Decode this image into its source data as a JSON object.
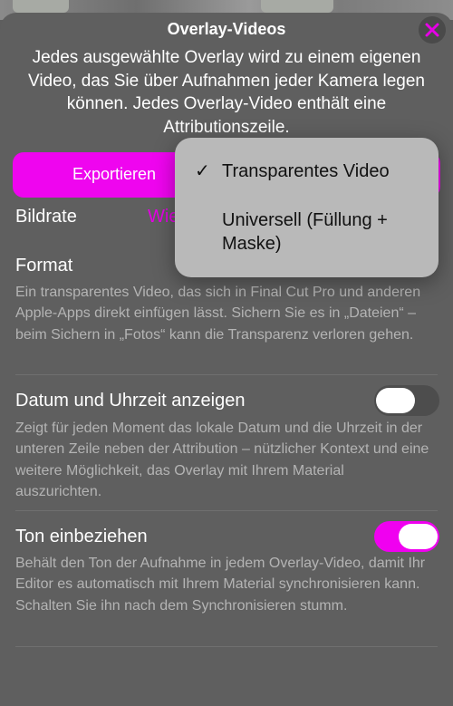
{
  "sheet": {
    "title": "Overlay-Videos",
    "intro": "Jedes ausgewählte Overlay wird zu einem eigenen Video, das Sie über Aufnahmen jeder Kamera legen können. Jedes Overlay-Video enthält eine Attributionszeile."
  },
  "export": {
    "label": "Exportieren"
  },
  "bildrate": {
    "label": "Bildrate",
    "value": "Wie"
  },
  "format": {
    "label": "Format",
    "description": "Ein transparentes Video, das sich in Final Cut Pro und anderen Apple-Apps direkt einfügen lässt. Sichern Sie es in „Dateien“ – beim Sichern in „Fotos“ kann die Transparenz verloren gehen."
  },
  "datetime": {
    "label": "Datum und Uhrzeit anzeigen",
    "description": "Zeigt für jeden Moment das lokale Datum und die Uhrzeit in der unteren Zeile neben der Attribution – nützlicher Kontext und eine weitere Möglichkeit, das Overlay mit Ihrem Material auszurichten.",
    "enabled": false
  },
  "sound": {
    "label": "Ton einbeziehen",
    "description": "Behält den Ton der Aufnahme in jedem Overlay-Video, damit Ihr Editor es automatisch mit Ihrem Material synchronisieren kann. Schalten Sie ihn nach dem Synchronisieren stumm.",
    "enabled": true
  },
  "format_menu": {
    "check": "✓",
    "options": [
      "Transparentes Video",
      "Universell (Füllung + Maske)"
    ],
    "selected": "Transparentes Video"
  },
  "colors": {
    "accent": "#ef05ef",
    "close_icon": "#e600e6"
  },
  "icons": {
    "close": "close-icon",
    "check": "checkmark-icon"
  }
}
